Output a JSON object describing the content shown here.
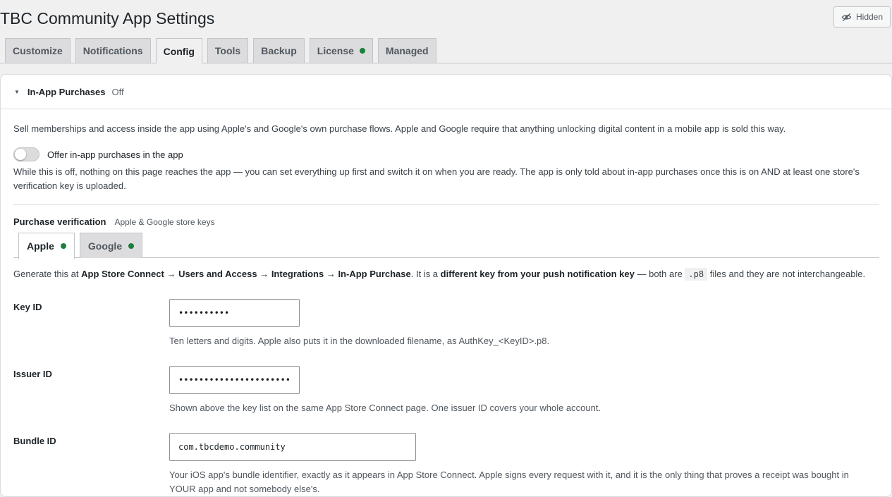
{
  "title": "TBC Community App Settings",
  "hidden_button": {
    "label": "Hidden",
    "icon": "eye-slash-icon"
  },
  "tabs": [
    {
      "label": "Customize"
    },
    {
      "label": "Notifications"
    },
    {
      "label": "Config",
      "active": true
    },
    {
      "label": "Tools"
    },
    {
      "label": "Backup"
    },
    {
      "label": "License",
      "status_dot": "#1a7f37"
    },
    {
      "label": "Managed"
    }
  ],
  "section": {
    "title": "In-App Purchases",
    "state": "Off",
    "intro": "Sell memberships and access inside the app using Apple's and Google's own purchase flows. Apple and Google require that anything unlocking digital content in a mobile app is sold this way.",
    "toggle": {
      "label": "Offer in-app purchases in the app",
      "on": false,
      "help": "While this is off, nothing on this page reaches the app — you can set everything up first and switch it on when you are ready. The app is only told about in-app purchases once this is on AND at least one store's verification key is uploaded."
    },
    "verification": {
      "title": "Purchase verification",
      "subtitle": "Apple & Google store keys",
      "tabs": [
        {
          "label": "Apple",
          "active": true,
          "status_dot": "#1a7f37"
        },
        {
          "label": "Google",
          "status_dot": "#1a7f37"
        }
      ],
      "generate": {
        "prefix": "Generate this at ",
        "path": "App Store Connect → Users and Access → Integrations → In-App Purchase",
        "mid": ". It is a ",
        "emphasis": "different key from your push notification key",
        "mid2": " — both are ",
        "code": ".p8",
        "suffix": " files and they are not interchangeable."
      },
      "fields": [
        {
          "label": "Key ID",
          "value": "••••••••••",
          "help": "Ten letters and digits. Apple also puts it in the downloaded filename, as AuthKey_<KeyID>.p8."
        },
        {
          "label": "Issuer ID",
          "value": "••••••••••••••••••••••••••••",
          "help": "Shown above the key list on the same App Store Connect page. One issuer ID covers your whole account."
        },
        {
          "label": "Bundle ID",
          "value": "com.tbcdemo.community",
          "help": "Your iOS app's bundle identifier, exactly as it appears in App Store Connect. Apple signs every request with it, and it is the only thing that proves a receipt was bought in YOUR app and not somebody else's."
        }
      ]
    }
  }
}
